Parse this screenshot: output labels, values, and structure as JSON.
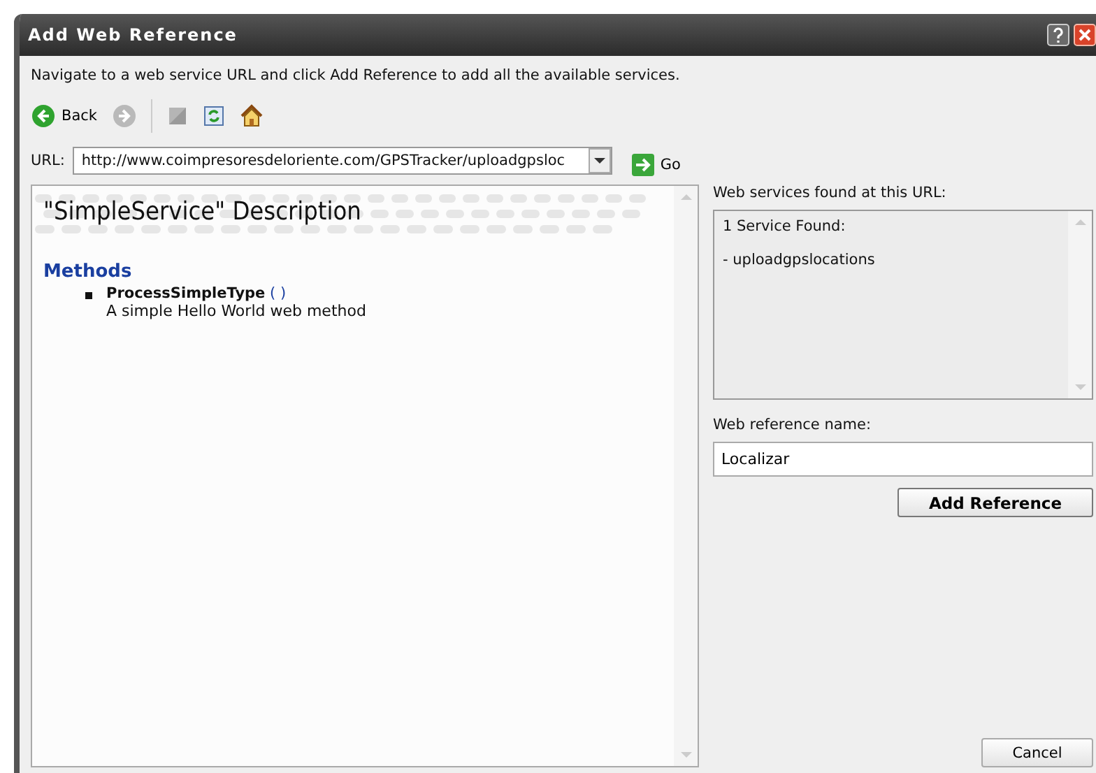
{
  "window": {
    "title": "Add Web Reference"
  },
  "instruction": "Navigate to a web service URL and click Add Reference to add all the available services.",
  "toolbar": {
    "back_label": "Back",
    "forward_disabled": true
  },
  "url": {
    "label": "URL:",
    "value": "http://www.coimpresoresdeloriente.com/GPSTracker/uploadgpsloc",
    "go_label": "Go"
  },
  "description": {
    "heading": "\"SimpleService\" Description",
    "methods_heading": "Methods",
    "methods": [
      {
        "name": "ProcessSimpleType",
        "params": "( )",
        "summary": "A simple Hello World web method"
      }
    ]
  },
  "services": {
    "label": "Web services found at this URL:",
    "lines": [
      "1 Service Found:",
      "- uploadgpslocations"
    ]
  },
  "reference_name": {
    "label": "Web reference name:",
    "value": "Localizar"
  },
  "buttons": {
    "add": "Add Reference",
    "cancel": "Cancel"
  }
}
